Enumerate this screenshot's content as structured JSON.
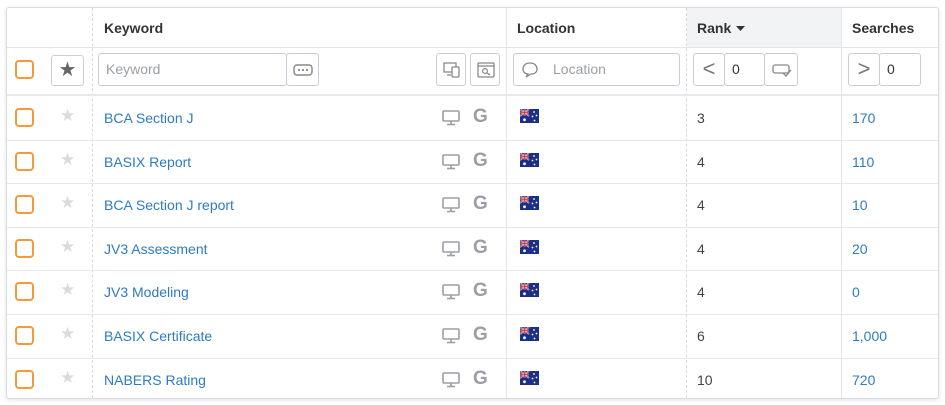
{
  "columns": {
    "keyword": "Keyword",
    "location": "Location",
    "rank": "Rank",
    "rank_sort_icon": "caret-down-icon",
    "searches": "Searches"
  },
  "filters": {
    "keyword_placeholder": "Keyword",
    "location_placeholder": "Location",
    "rank_operator": "<",
    "rank_value": "0",
    "searches_operator": ">",
    "searches_value": "0"
  },
  "rows": [
    {
      "keyword": "BCA Section J",
      "rank": "3",
      "searches": "170"
    },
    {
      "keyword": "BASIX Report",
      "rank": "4",
      "searches": "110"
    },
    {
      "keyword": "BCA Section J report",
      "rank": "4",
      "searches": "10"
    },
    {
      "keyword": "JV3 Assessment",
      "rank": "4",
      "searches": "20"
    },
    {
      "keyword": "JV3 Modeling",
      "rank": "4",
      "searches": "0"
    },
    {
      "keyword": "BASIX Certificate",
      "rank": "6",
      "searches": "1,000"
    },
    {
      "keyword": "NABERS Rating",
      "rank": "10",
      "searches": "720"
    }
  ],
  "row_icons": {
    "device": "desktop-icon",
    "engine": "google-icon",
    "engine_glyph": "G",
    "flag": "australia-flag-icon"
  },
  "colors": {
    "checkbox": "#f39a3b",
    "link": "#2e7bc2",
    "border": "#c9ced6"
  }
}
